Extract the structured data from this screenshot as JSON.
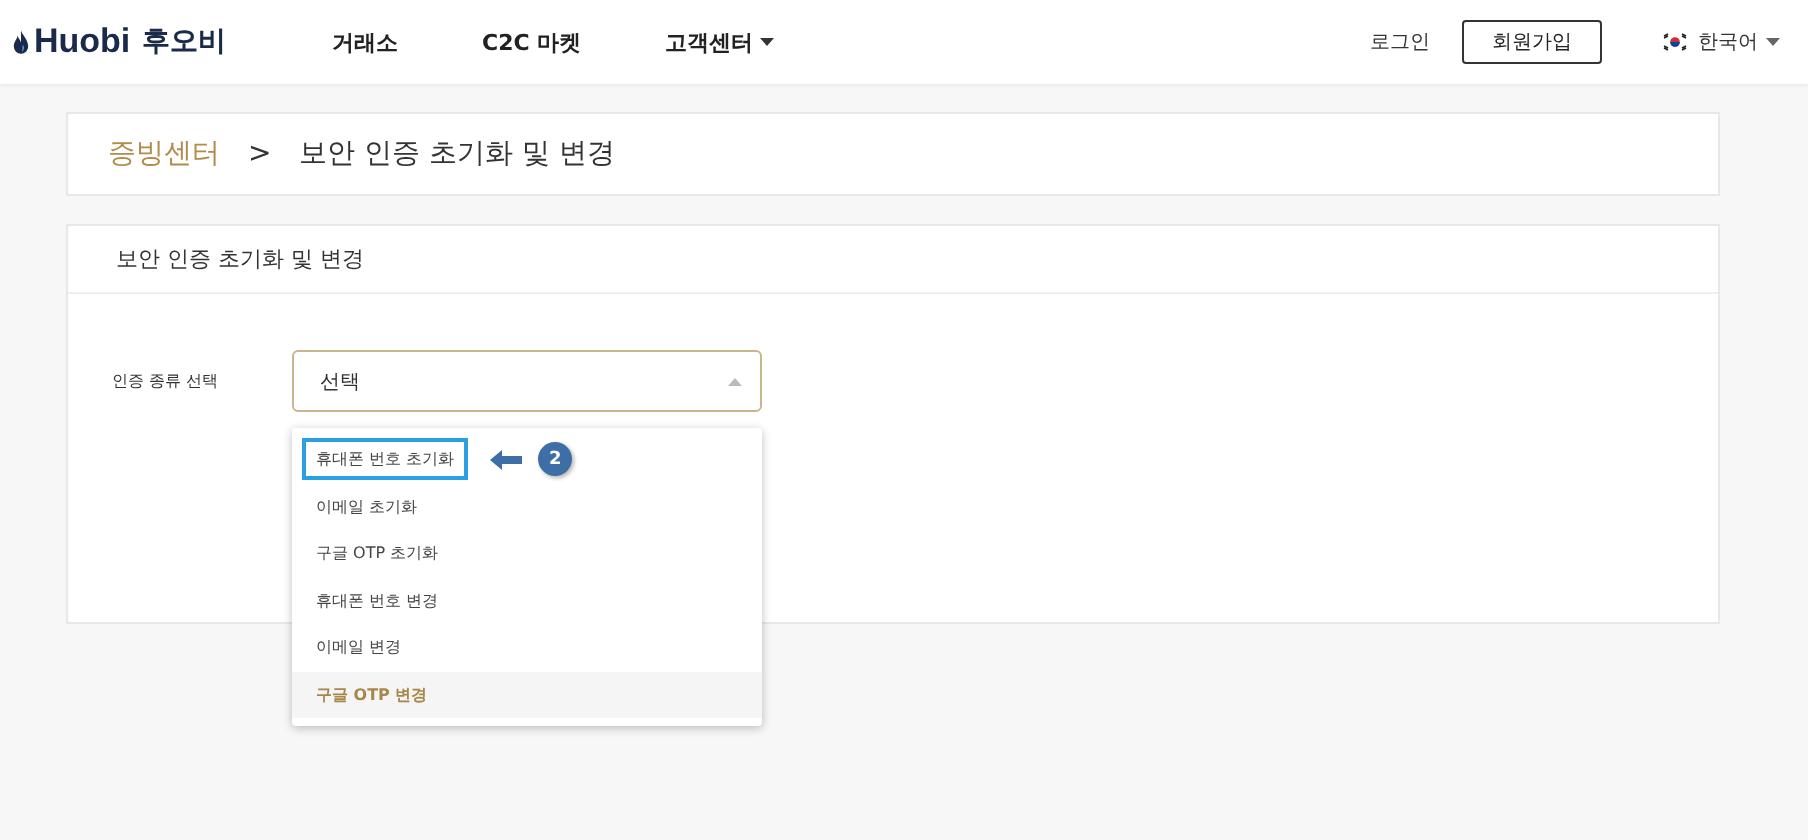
{
  "header": {
    "logo_text": "Huobi",
    "brand": "후오비",
    "nav": [
      {
        "label": "거래소",
        "has_caret": false
      },
      {
        "label": "C2C 마켓",
        "has_caret": false
      },
      {
        "label": "고객센터",
        "has_caret": true
      }
    ],
    "login": "로그인",
    "signup": "회원가입",
    "language": "한국어"
  },
  "breadcrumb": {
    "parent": "증빙센터",
    "separator": ">",
    "current": "보안 인증 초기화 및 변경"
  },
  "panel": {
    "title": "보안 인증 초기화 및 변경",
    "field_label": "인증 종류 선택",
    "select": {
      "value": "선택",
      "expanded": true
    },
    "options": [
      {
        "label": "휴대폰 번호 초기화",
        "selected": false,
        "highlighted": true
      },
      {
        "label": "이메일 초기화",
        "selected": false,
        "highlighted": false
      },
      {
        "label": "구글 OTP 초기화",
        "selected": false,
        "highlighted": false
      },
      {
        "label": "휴대폰 번호 변경",
        "selected": false,
        "highlighted": false
      },
      {
        "label": "이메일 변경",
        "selected": false,
        "highlighted": false
      },
      {
        "label": "구글 OTP 변경",
        "selected": true,
        "highlighted": false
      }
    ],
    "annotation": {
      "number": "2"
    }
  }
}
